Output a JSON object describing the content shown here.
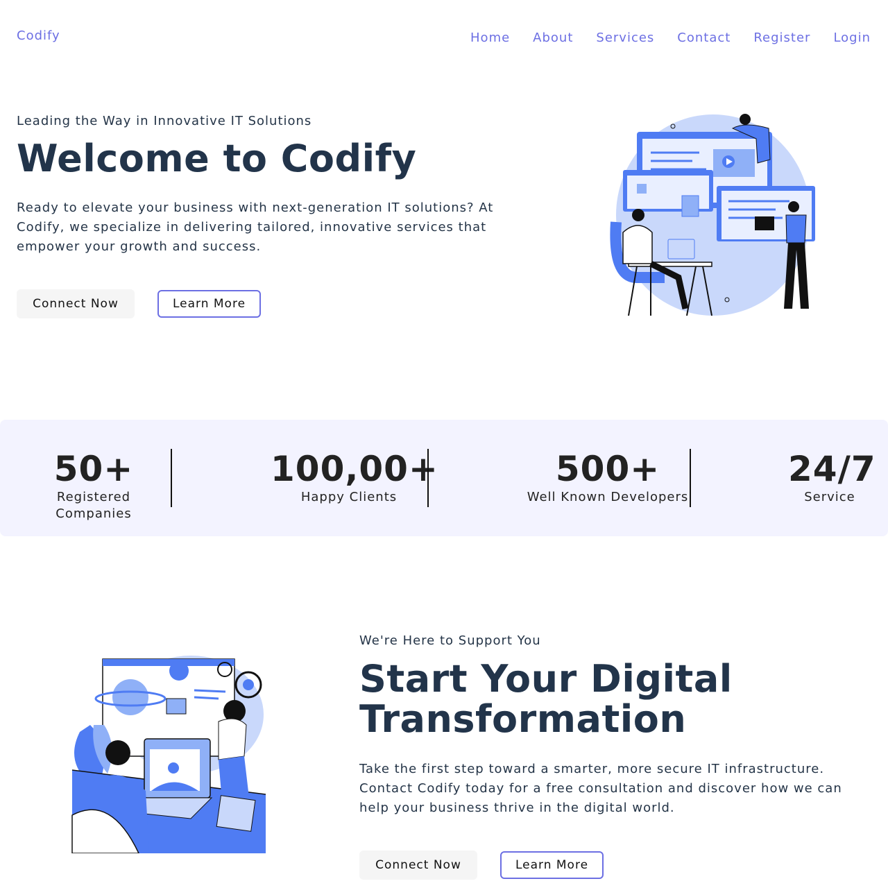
{
  "nav": {
    "brand": "Codify",
    "links": [
      "Home",
      "About",
      "Services",
      "Contact",
      "Register",
      "Login"
    ]
  },
  "hero": {
    "eyebrow": "Leading the Way in Innovative IT Solutions",
    "title": "Welcome to Codify",
    "description": "Ready to elevate your business with next-generation IT solutions? At Codify, we specialize in delivering tailored, innovative services that empower your growth and success.",
    "primary_button": "Connect Now",
    "secondary_button": "Learn More"
  },
  "stats": [
    {
      "value": "50+",
      "label": "Registered Companies"
    },
    {
      "value": "100,00+",
      "label": "Happy Clients"
    },
    {
      "value": "500+",
      "label": "Well Known Developers"
    },
    {
      "value": "24/7",
      "label": "Service"
    }
  ],
  "support": {
    "eyebrow": "We're Here to Support You",
    "title": "Start Your Digital Transformation",
    "description": "Take the first step toward a smarter, more secure IT infrastructure. Contact Codify today for a free consultation and discover how we can help your business thrive in the digital world.",
    "primary_button": "Connect Now",
    "secondary_button": "Learn More"
  },
  "colors": {
    "accent": "#6c6fe3",
    "illustration_blue": "#4f7cf3",
    "illustration_light": "#c9d8fb",
    "stats_bg": "#f3f3ff",
    "heading": "#22344a"
  },
  "icons": [
    "team-working-illustration",
    "digital-design-illustration"
  ]
}
